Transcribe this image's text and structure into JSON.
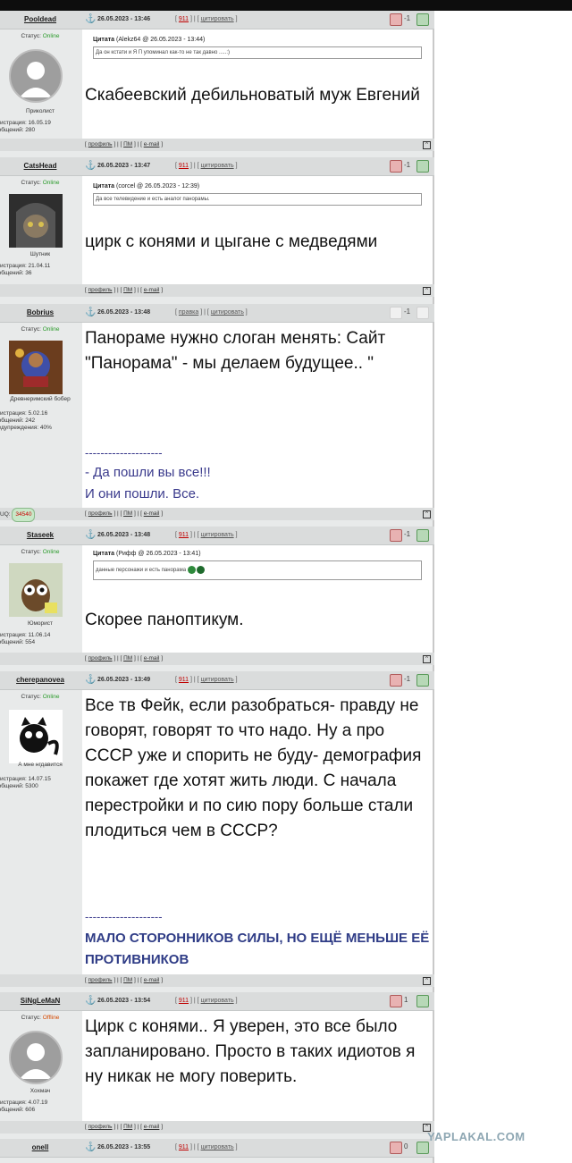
{
  "watermark": "YAPLAKAL.COM",
  "posts": [
    {
      "user": "Pooldead",
      "date": "26.05.2023 - 13:46",
      "link_a": "911",
      "link_b": "цитировать",
      "score": "-1",
      "status_label": "Статус:",
      "status": "Online",
      "title": "Приколист",
      "meta1": "егистрация: 16.05.19",
      "meta2": "ообщений: 280",
      "quote_label": "Цитата",
      "quote_meta": "(Alekz64 @ 26.05.2023 - 13:44)",
      "quote_text": "Да он кстати и Я П упоминал как-то не так давно .....:)",
      "message": "Скабеевский дебильноватый муж Евгений"
    },
    {
      "user": "CatsHead",
      "date": "26.05.2023 - 13:47",
      "link_a": "911",
      "link_b": "цитировать",
      "score": "-1",
      "status_label": "Статус:",
      "status": "Online",
      "title": "Шутник",
      "meta1": "егистрация: 21.04.11",
      "meta2": "ообщений: 36",
      "quote_label": "Цитата",
      "quote_meta": "(corcel @ 26.05.2023 - 12:39)",
      "quote_text": "Да все телевидение и есть аналог панорамы.",
      "message": "цирк с конями и цыгане с медведями"
    },
    {
      "user": "Bobrius",
      "date": "26.05.2023 - 13:48",
      "link_a": "правка",
      "link_b": "цитировать",
      "score": "-1",
      "status_label": "Статус:",
      "status": "Online",
      "title": "Древнеримский бобер",
      "meta1": "егистрация: 5.02.16",
      "meta2": "ообщений: 242",
      "meta3": "редупреждения: 40%",
      "message": "Панораме нужно слоган менять: Сайт \"Панорама\" - мы делаем будущее.. \"",
      "sig_line": "--------------------",
      "sig1": "- Да пошли вы все!!!",
      "sig2": "И они пошли. Все.",
      "uq_label": "UQ:",
      "uq_value": "34540"
    },
    {
      "user": "Staseek",
      "date": "26.05.2023 - 13:48",
      "link_a": "911",
      "link_b": "цитировать",
      "score": "-1",
      "status_label": "Статус:",
      "status": "Online",
      "title": "Юморист",
      "meta1": "егистрация: 11.06.14",
      "meta2": "ообщений: 554",
      "quote_label": "Цитата",
      "quote_meta": "(Рифф @ 26.05.2023 - 13:41)",
      "quote_text": "данные персонажи и есть панорама",
      "message": "Скорее паноптикум."
    },
    {
      "user": "cherepanovea",
      "date": "26.05.2023 - 13:49",
      "link_a": "911",
      "link_b": "цитировать",
      "score": "-1",
      "status_label": "Статус:",
      "status": "Online",
      "title": "А мне нгдавится",
      "meta1": "егистрация: 14.07.15",
      "meta2": "ообщений: 5300",
      "message": "Все тв Фейк, если разобраться- правду не говорят, говорят то что надо. Ну а про СССР уже и спорить не буду- демография покажет где хотят жить люди. С начала перестройки и по сию пору больше стали плодиться чем в СССР?",
      "sig_line": "--------------------",
      "sig1": "МАЛО СТОРОННИКОВ СИЛЫ, НО ЕЩЁ МЕНЬШЕ ЕЁ ПРОТИВНИКОВ"
    },
    {
      "user": "SiNgLeMaN",
      "date": "26.05.2023 - 13:54",
      "link_a": "911",
      "link_b": "цитировать",
      "score": "1",
      "status_label": "Статус:",
      "status": "Offline",
      "title": "Хохмач",
      "meta1": "егистрация: 4.07.19",
      "meta2": "ообщений: 606",
      "message": "Цирк с конями.. Я уверен, это все было запланировано. Просто в таких идиотов я ну никак не могу поверить."
    },
    {
      "user": "onell",
      "date": "26.05.2023 - 13:55",
      "link_a": "911",
      "link_b": "цитировать",
      "score": "0"
    }
  ],
  "footer": {
    "profile": "профиль",
    "pm": "ПМ",
    "email": "e-mail"
  }
}
